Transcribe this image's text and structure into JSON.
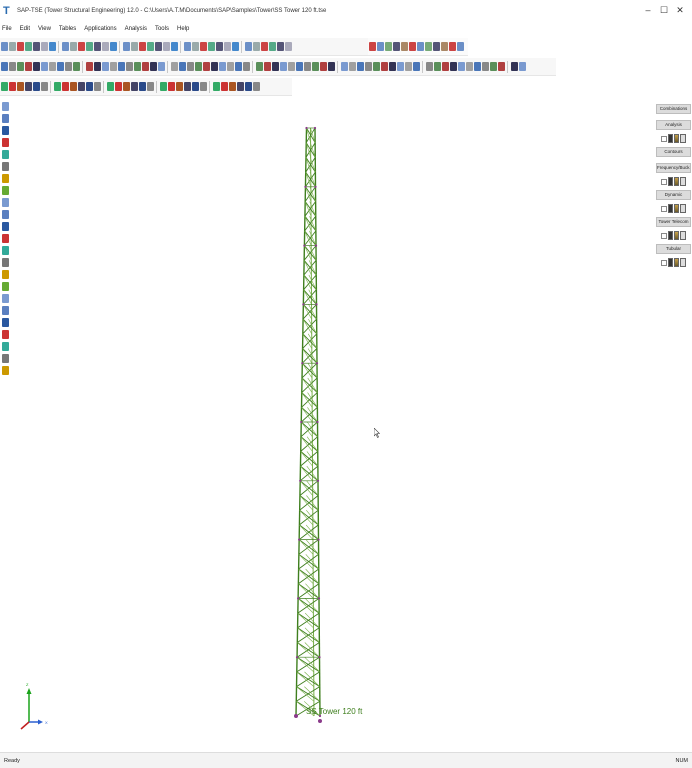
{
  "window": {
    "title": "SAP-TSE (Tower Structural Engineering) 12.0 - C:\\Users\\A.T.M\\Documents\\SAP\\Samples\\Tower\\SS Tower 120 ft.tse",
    "controls": [
      "–",
      "☐",
      "✕"
    ]
  },
  "menu": [
    "File",
    "Edit",
    "View",
    "Tables",
    "Applications",
    "Analysis",
    "Tools",
    "Help"
  ],
  "right_panel": {
    "sections": [
      {
        "label": "Combinations",
        "has_row": false
      },
      {
        "label": "Analysis",
        "has_row": true
      },
      {
        "label": "Contours",
        "has_row": false
      },
      {
        "label": "Frequency/Buck.",
        "has_row": true
      },
      {
        "label": "Dynamic",
        "has_row": true
      },
      {
        "label": "Tower Telecom",
        "has_row": true
      },
      {
        "label": "Tubular",
        "has_row": true
      }
    ]
  },
  "viewport": {
    "model_label": "SS Tower 120 ft",
    "axis_labels": {
      "z": "Z",
      "x": "X"
    }
  },
  "status": {
    "left": "Ready",
    "right": "NUM"
  },
  "colors": {
    "tower_member": "#3f7f1e",
    "tower_member_light": "#79b04a",
    "node": "#8a3a8a",
    "axis_z": "#1aa31a",
    "axis_x": "#2b5fd0",
    "axis_y": "#c02020"
  }
}
